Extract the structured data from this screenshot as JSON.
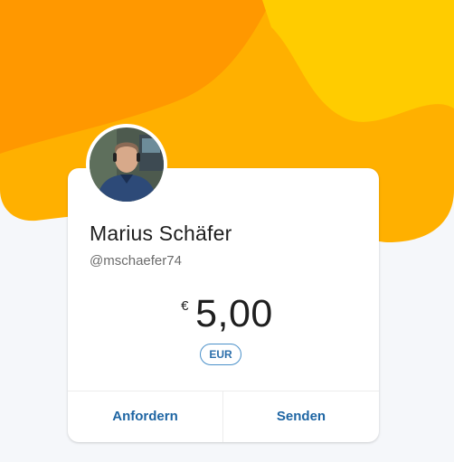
{
  "profile": {
    "name": "Marius Schäfer",
    "handle": "@mschaefer74"
  },
  "payment": {
    "currency_symbol": "€",
    "amount": "5,00",
    "currency_code": "EUR"
  },
  "actions": {
    "request_label": "Anfordern",
    "send_label": "Senden"
  },
  "theme": {
    "banner_orange": "#ff9a00",
    "banner_yellow": "#ffc200",
    "link_blue": "#1e65a3",
    "badge_border": "#4a90c9"
  }
}
